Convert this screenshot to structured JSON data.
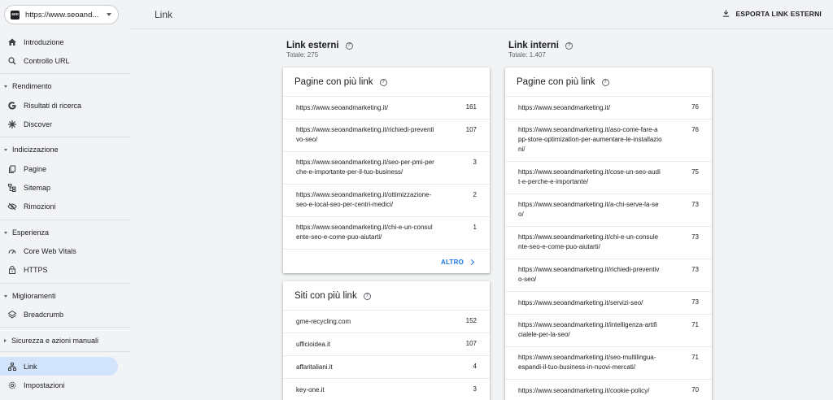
{
  "property": {
    "favicon": "seo",
    "url": "https://www.seoand..."
  },
  "sidebar": {
    "items": [
      {
        "label": "Introduzione",
        "icon": "home-icon"
      },
      {
        "label": "Controllo URL",
        "icon": "search-icon"
      }
    ],
    "sections": [
      {
        "label": "Rendimento",
        "items": [
          {
            "label": "Risultati di ricerca",
            "icon": "google-icon"
          },
          {
            "label": "Discover",
            "icon": "asterisk-icon"
          }
        ]
      },
      {
        "label": "Indicizzazione",
        "items": [
          {
            "label": "Pagine",
            "icon": "pages-icon"
          },
          {
            "label": "Sitemap",
            "icon": "sitemap-icon"
          },
          {
            "label": "Rimozioni",
            "icon": "eye-off-icon"
          }
        ]
      },
      {
        "label": "Esperienza",
        "items": [
          {
            "label": "Core Web Vitals",
            "icon": "gauge-icon"
          },
          {
            "label": "HTTPS",
            "icon": "lock-icon"
          }
        ]
      },
      {
        "label": "Miglioramenti",
        "items": [
          {
            "label": "Breadcrumb",
            "icon": "layers-icon"
          }
        ]
      },
      {
        "label": "Sicurezza e azioni manuali",
        "items": []
      }
    ],
    "bottom": [
      {
        "label": "Link",
        "icon": "link-tree-icon",
        "active": true
      },
      {
        "label": "Impostazioni",
        "icon": "gear-icon"
      }
    ]
  },
  "header": {
    "title": "Link",
    "export_label": "ESPORTA LINK ESTERNI"
  },
  "external": {
    "title": "Link esterni",
    "total": "Totale: 275",
    "top_pages": {
      "title": "Pagine con più link",
      "rows": [
        {
          "lines": [
            "https://www.seoandmarketing.it/"
          ],
          "value": "161"
        },
        {
          "lines": [
            "https://www.seoandmarketing.it/richiedi-preventi",
            "vo-seo/"
          ],
          "value": "107"
        },
        {
          "lines": [
            "https://www.seoandmarketing.it/seo-per-pmi-per",
            "che-e-importante-per-il-tuo-business/"
          ],
          "value": "3"
        },
        {
          "lines": [
            "https://www.seoandmarketing.it/ottimizzazione-",
            "seo-e-local-seo-per-centri-medici/"
          ],
          "value": "2"
        },
        {
          "lines": [
            "https://www.seoandmarketing.it/chi-e-un-consul",
            "ente-seo-e-come-puo-aiutarti/"
          ],
          "value": "1"
        }
      ],
      "more_label": "ALTRO"
    },
    "top_sites": {
      "title": "Siti con più link",
      "rows": [
        {
          "lines": [
            "gme-recycling.com"
          ],
          "value": "152"
        },
        {
          "lines": [
            "ufficioidea.it"
          ],
          "value": "107"
        },
        {
          "lines": [
            "affaritaliani.it"
          ],
          "value": "4"
        },
        {
          "lines": [
            "key-one.it"
          ],
          "value": "3"
        }
      ]
    }
  },
  "internal": {
    "title": "Link interni",
    "total": "Totale: 1.407",
    "top_pages": {
      "title": "Pagine con più link",
      "rows": [
        {
          "lines": [
            "https://www.seoandmarketing.it/"
          ],
          "value": "76"
        },
        {
          "lines": [
            "https://www.seoandmarketing.it/aso-come-fare-a",
            "pp-store-optimization-per-aumentare-le-installazio",
            "ni/"
          ],
          "value": "76"
        },
        {
          "lines": [
            "https://www.seoandmarketing.it/cose-un-seo-audi",
            "t-e-perche-e-importante/"
          ],
          "value": "75"
        },
        {
          "lines": [
            "https://www.seoandmarketing.it/a-chi-serve-la-se",
            "o/"
          ],
          "value": "73"
        },
        {
          "lines": [
            "https://www.seoandmarketing.it/chi-e-un-consule",
            "nte-seo-e-come-puo-aiutarti/"
          ],
          "value": "73"
        },
        {
          "lines": [
            "https://www.seoandmarketing.it/richiedi-preventiv",
            "o-seo/"
          ],
          "value": "73"
        },
        {
          "lines": [
            "https://www.seoandmarketing.it/servizi-seo/"
          ],
          "value": "73"
        },
        {
          "lines": [
            "https://www.seoandmarketing.it/intelligenza-artifi",
            "cialele-per-la-seo/"
          ],
          "value": "71"
        },
        {
          "lines": [
            "https://www.seoandmarketing.it/seo-multilingua-",
            "espandi-il-tuo-business-in-nuovi-mercati/"
          ],
          "value": "71"
        },
        {
          "lines": [
            "https://www.seoandmarketing.it/cookie-policy/"
          ],
          "value": "70"
        }
      ]
    }
  }
}
